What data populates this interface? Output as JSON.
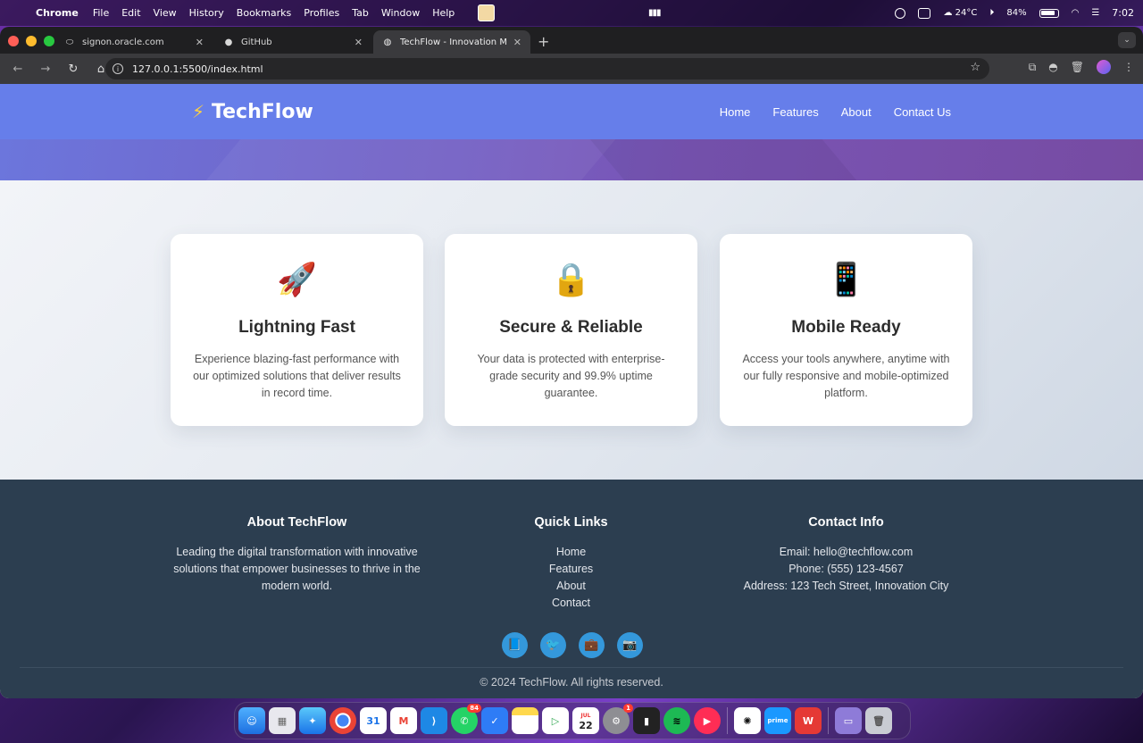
{
  "menubar": {
    "app": "Chrome",
    "items": [
      "File",
      "Edit",
      "View",
      "History",
      "Bookmarks",
      "Profiles",
      "Tab",
      "Window",
      "Help"
    ],
    "weather": "24°C",
    "battery": "84%",
    "clock": "7:02"
  },
  "tabs": [
    {
      "title": "signon.oracle.com",
      "icon": "oracle-icon"
    },
    {
      "title": "GitHub",
      "icon": "github-icon"
    },
    {
      "title": "TechFlow - Innovation Made S",
      "icon": "globe-icon"
    }
  ],
  "address": {
    "url": "127.0.0.1:5500/index.html"
  },
  "site": {
    "logo_icon": "⚡",
    "logo_text": "TechFlow",
    "nav": [
      "Home",
      "Features",
      "About",
      "Contact Us"
    ],
    "brand_color": "#667eea",
    "accent_color": "#764ba2"
  },
  "features": [
    {
      "emoji": "🚀",
      "title": "Lightning Fast",
      "text": "Experience blazing-fast performance with our optimized solutions that deliver results in record time."
    },
    {
      "emoji": "🔒",
      "title": "Secure & Reliable",
      "text": "Your data is protected with enterprise-grade security and 99.9% uptime guarantee."
    },
    {
      "emoji": "📱",
      "title": "Mobile Ready",
      "text": "Access your tools anywhere, anytime with our fully responsive and mobile-optimized platform."
    }
  ],
  "footer": {
    "about_title": "About TechFlow",
    "about_text": "Leading the digital transformation with innovative solutions that empower businesses to thrive in the modern world.",
    "links_title": "Quick Links",
    "links": [
      "Home",
      "Features",
      "About",
      "Contact"
    ],
    "contact_title": "Contact Info",
    "email": "Email: hello@techflow.com",
    "phone": "Phone: (555) 123-4567",
    "address": "Address: 123 Tech Street, Innovation City",
    "socials": [
      "📘",
      "🐦",
      "💼",
      "📷"
    ],
    "copyright": "© 2024 TechFlow. All rights reserved."
  },
  "dock": {
    "calendar_day": "22",
    "calendar_month": "JUL",
    "whatsapp_badge": "84",
    "settings_badge": "1"
  }
}
